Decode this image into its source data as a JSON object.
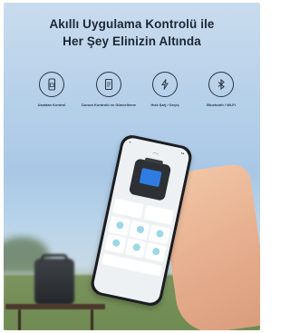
{
  "headline": {
    "line1": "Akıllı Uygulama Kontrolü ile",
    "line2": "Her Şey Elinizin Altında"
  },
  "features": [
    {
      "icon": "phone-app-icon",
      "label": "Uzaktan Kontrol"
    },
    {
      "icon": "device-settings-icon",
      "label": "Durum Kontrolü ve Güncelleme"
    },
    {
      "icon": "power-icon",
      "label": "Hızlı Şarj / Geçiş"
    },
    {
      "icon": "bluetooth-wifi-icon",
      "label": "Bluetooth / Wi-Fi"
    }
  ],
  "colors": {
    "headline": "#1d2733",
    "device_screen": "#2f7de0"
  }
}
